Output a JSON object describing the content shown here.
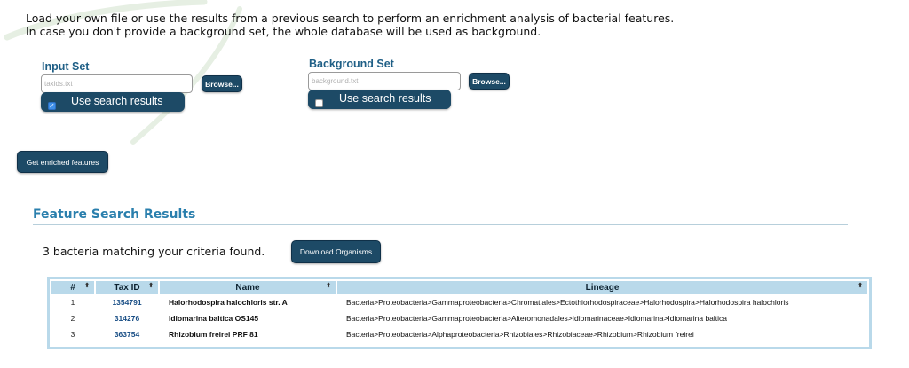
{
  "intro": {
    "line1": "Load your own file or use the results from a previous search to perform an enrichment analysis of bacterial features.",
    "line2": "In case you don't provide a background set, the whole database will be used as background."
  },
  "input_set": {
    "label": "Input Set",
    "placeholder": "taxids.txt",
    "browse_label": "Browse...",
    "use_search_label": "Use search results",
    "use_search_checked": true
  },
  "background_set": {
    "label": "Background Set",
    "placeholder": "background.txt",
    "browse_label": "Browse...",
    "use_search_label": "Use search results",
    "use_search_checked": false
  },
  "enrich_button_label": "Get enriched features",
  "results": {
    "title": "Feature Search Results",
    "count_text": "3 bacteria matching your criteria found.",
    "download_label": "Download Organisms",
    "columns": [
      "#",
      "Tax ID",
      "Name",
      "Lineage"
    ],
    "rows": [
      {
        "num": "1",
        "taxid": "1354791",
        "name": "Halorhodospira halochloris str. A",
        "lineage": "Bacteria>Proteobacteria>Gammaproteobacteria>Chromatiales>Ectothiorhodospiraceae>Halorhodospira>Halorhodospira halochloris"
      },
      {
        "num": "2",
        "taxid": "314276",
        "name": "Idiomarina baltica OS145",
        "lineage": "Bacteria>Proteobacteria>Gammaproteobacteria>Alteromonadales>Idiomarinaceae>Idiomarina>Idiomarina baltica"
      },
      {
        "num": "3",
        "taxid": "363754",
        "name": "Rhizobium freirei PRF 81",
        "lineage": "Bacteria>Proteobacteria>Alphaproteobacteria>Rhizobiales>Rhizobiaceae>Rhizobium>Rhizobium freirei"
      }
    ]
  },
  "colors": {
    "button_dark": "#1d4a66",
    "label_blue": "#1f5f86",
    "section_title": "#2a7fad",
    "table_header": "#b9d9ea",
    "taxid_link": "#1a4f86"
  },
  "icons": {
    "sort": "sort-arrows-icon",
    "check": "checkmark-icon"
  }
}
